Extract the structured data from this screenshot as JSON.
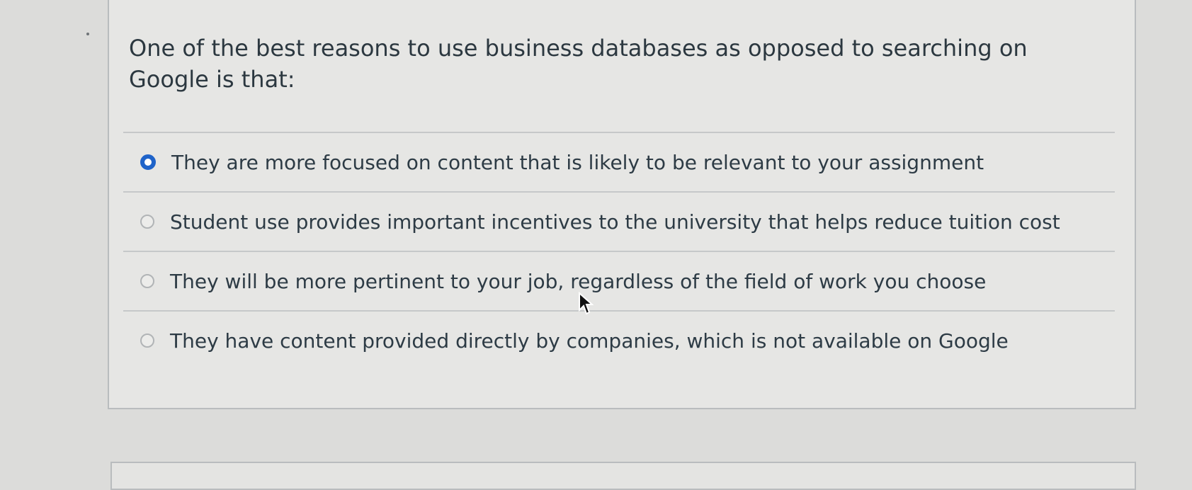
{
  "question": {
    "text": "One of the best reasons to use business databases as opposed to searching on Google is that:",
    "answers": [
      {
        "label": "They are more focused on content that is likely to be relevant to your assignment",
        "selected": true
      },
      {
        "label": "Student use provides important incentives to the university that helps reduce tuition cost",
        "selected": false
      },
      {
        "label": "They will be more pertinent to your job, regardless of the field of work you choose",
        "selected": false
      },
      {
        "label": "They have content provided directly by companies, which is not available on Google",
        "selected": false
      }
    ]
  },
  "icons": {
    "cursor": "mouse-pointer-icon",
    "selected_radio": "radio-checked-icon",
    "unselected_radio": "radio-unchecked-icon"
  },
  "colors": {
    "selected_radio": "#1f63c9",
    "page_background": "#dcdcda",
    "card_background": "#e6e6e4",
    "card_border": "#b9bcbe",
    "text": "#2d3b45"
  }
}
